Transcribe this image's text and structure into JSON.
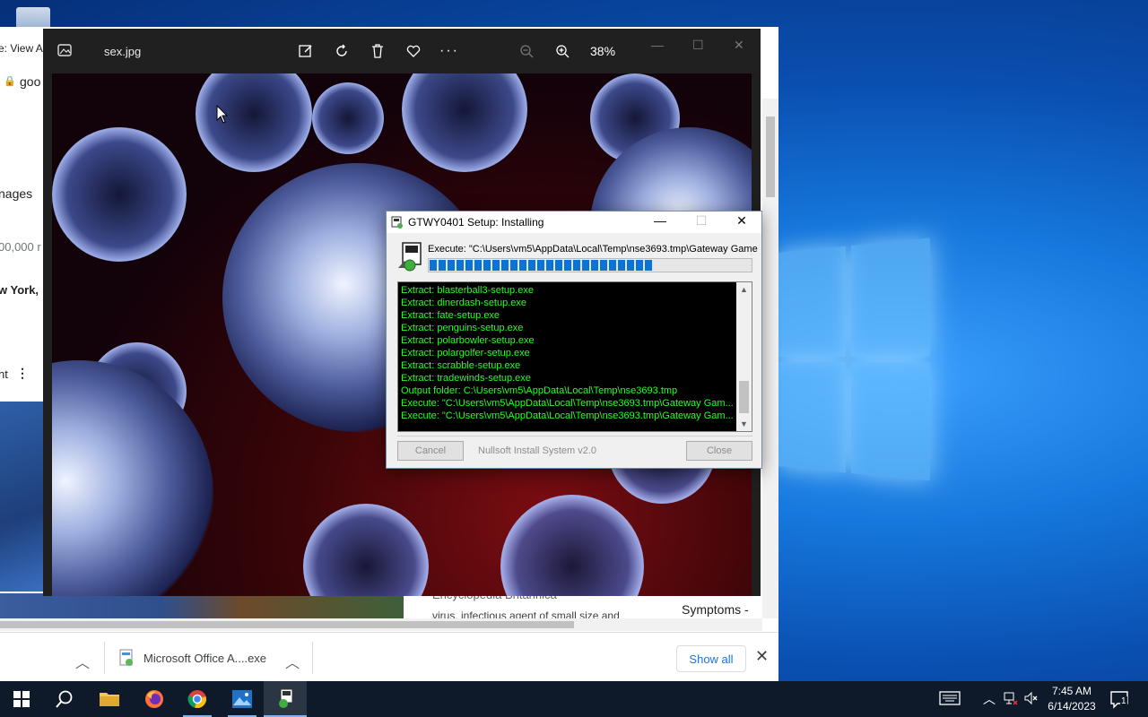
{
  "photos": {
    "filename": "sex.jpg",
    "zoom": "38%",
    "tools": [
      "edit-icon",
      "rotate-icon",
      "delete-icon",
      "favorite-icon",
      "more-icon"
    ]
  },
  "chrome": {
    "fragments": {
      "tab": "e: View A",
      "url": "goo",
      "images": "nages",
      "results": "00,000 r",
      "location": "w York,",
      "nt": "nt"
    },
    "result_source": "Encyclopedia Britannica",
    "result_snippet": "virus, infectious agent of small size and",
    "symptoms": "Symptoms -"
  },
  "download_bar": {
    "file_name": "Microsoft Office A....exe",
    "show_all": "Show all"
  },
  "installer": {
    "title": "GTWY0401 Setup: Installing",
    "execute_line": "Execute: \"C:\\Users\\vm5\\AppData\\Local\\Temp\\nse3693.tmp\\Gateway Game",
    "progress_percent": 70,
    "log": [
      "Extract: blasterball3-setup.exe",
      "Extract: dinerdash-setup.exe",
      "Extract: fate-setup.exe",
      "Extract: penguins-setup.exe",
      "Extract: polarbowler-setup.exe",
      "Extract: polargolfer-setup.exe",
      "Extract: scrabble-setup.exe",
      "Extract: tradewinds-setup.exe",
      "Output folder: C:\\Users\\vm5\\AppData\\Local\\Temp\\nse3693.tmp",
      "Execute: \"C:\\Users\\vm5\\AppData\\Local\\Temp\\nse3693.tmp\\Gateway Gam...",
      "Execute: \"C:\\Users\\vm5\\AppData\\Local\\Temp\\nse3693.tmp\\Gateway Gam..."
    ],
    "cancel_label": "Cancel",
    "brand": "Nullsoft Install System v2.0",
    "close_label": "Close"
  },
  "taskbar": {
    "time": "7:45 AM",
    "date": "6/14/2023",
    "notification_count": "1"
  }
}
